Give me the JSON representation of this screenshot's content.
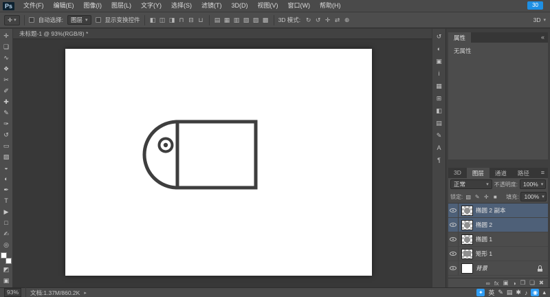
{
  "window": {
    "logo": "Ps",
    "badge": "30"
  },
  "ui": {
    "dropdown_arrow": "▾",
    "collapse_arrow": "«",
    "panel_menu": "≡",
    "status_arrow": "▸"
  },
  "menu_bar": {
    "items": [
      {
        "name": "menu-file",
        "label": "文件(F)"
      },
      {
        "name": "menu-edit",
        "label": "编辑(E)"
      },
      {
        "name": "menu-image",
        "label": "图像(I)"
      },
      {
        "name": "menu-layer",
        "label": "图层(L)"
      },
      {
        "name": "menu-type",
        "label": "文字(Y)"
      },
      {
        "name": "menu-select",
        "label": "选择(S)"
      },
      {
        "name": "menu-filter",
        "label": "滤镜(T)"
      },
      {
        "name": "menu-3d",
        "label": "3D(D)"
      },
      {
        "name": "menu-view",
        "label": "视图(V)"
      },
      {
        "name": "menu-window",
        "label": "窗口(W)"
      },
      {
        "name": "menu-help",
        "label": "帮助(H)"
      }
    ]
  },
  "options_bar": {
    "tool_icon": "✛",
    "auto_select_label": "自动选择:",
    "auto_select_value": "图层",
    "show_transform_label": "显示变换控件",
    "align_icons": [
      {
        "name": "align-left-icon",
        "glyph": "◧"
      },
      {
        "name": "align-center-horizontal-icon",
        "glyph": "◫"
      },
      {
        "name": "align-right-icon",
        "glyph": "◨"
      },
      {
        "name": "align-top-icon",
        "glyph": "⊓"
      },
      {
        "name": "align-center-vertical-icon",
        "glyph": "⊟"
      },
      {
        "name": "align-bottom-icon",
        "glyph": "⊔"
      }
    ],
    "distribute_icons": [
      {
        "name": "distribute-top-icon",
        "glyph": "▤"
      },
      {
        "name": "distribute-vertical-icon",
        "glyph": "▦"
      },
      {
        "name": "distribute-bottom-icon",
        "glyph": "▥"
      },
      {
        "name": "distribute-left-icon",
        "glyph": "▧"
      },
      {
        "name": "distribute-horizontal-icon",
        "glyph": "▨"
      },
      {
        "name": "distribute-right-icon",
        "glyph": "▩"
      }
    ],
    "mode_label": "3D 模式:",
    "mode_icons": [
      {
        "name": "3d-rotate-icon",
        "glyph": "↻"
      },
      {
        "name": "3d-roll-icon",
        "glyph": "↺"
      },
      {
        "name": "3d-drag-icon",
        "glyph": "✛"
      },
      {
        "name": "3d-slide-icon",
        "glyph": "⇄"
      },
      {
        "name": "3d-scale-icon",
        "glyph": "⊕"
      }
    ],
    "workspace_label": "3D"
  },
  "toolbar": {
    "tools": [
      {
        "name": "move-tool",
        "glyph": "✛"
      },
      {
        "name": "rectangular-marquee-tool",
        "glyph": "❏"
      },
      {
        "name": "lasso-tool",
        "glyph": "∿"
      },
      {
        "name": "quick-selection-tool",
        "glyph": "❖"
      },
      {
        "name": "crop-tool",
        "glyph": "✂"
      },
      {
        "name": "eyedropper-tool",
        "glyph": "✐"
      },
      {
        "name": "healing-brush-tool",
        "glyph": "✚"
      },
      {
        "name": "brush-tool",
        "glyph": "✎"
      },
      {
        "name": "clone-stamp-tool",
        "glyph": "✑"
      },
      {
        "name": "history-brush-tool",
        "glyph": "↺"
      },
      {
        "name": "eraser-tool",
        "glyph": "▭"
      },
      {
        "name": "gradient-tool",
        "glyph": "▨"
      },
      {
        "name": "blur-tool",
        "glyph": "◒"
      },
      {
        "name": "dodge-tool",
        "glyph": "◐"
      },
      {
        "name": "pen-tool",
        "glyph": "✒"
      },
      {
        "name": "type-tool",
        "glyph": "T"
      },
      {
        "name": "path-selection-tool",
        "glyph": "▶"
      },
      {
        "name": "rectangle-tool",
        "glyph": "□"
      },
      {
        "name": "hand-tool",
        "glyph": "✍"
      },
      {
        "name": "zoom-tool",
        "glyph": "◎"
      }
    ]
  },
  "document": {
    "tab": "未标题-1 @ 93%(RGB/8) *"
  },
  "canvas": {
    "background": "#ffffff",
    "stroke": "#3e3e3e"
  },
  "panel_dock": {
    "icons": [
      {
        "name": "history-panel-icon",
        "glyph": "↺"
      },
      {
        "name": "adjustments-panel-icon",
        "glyph": "◐"
      },
      {
        "name": "masks-panel-icon",
        "glyph": "▣"
      },
      {
        "name": "info-panel-icon",
        "glyph": "i"
      },
      {
        "name": "histogram-panel-icon",
        "glyph": "▦"
      },
      {
        "name": "navigator-panel-icon",
        "glyph": "⊞"
      },
      {
        "name": "color-panel-icon",
        "glyph": "◧"
      },
      {
        "name": "swatches-panel-icon",
        "glyph": "▤"
      },
      {
        "name": "brush-panel-icon",
        "glyph": "✎"
      },
      {
        "name": "character-panel-icon",
        "glyph": "A"
      },
      {
        "name": "paragraph-panel-icon",
        "glyph": "¶"
      }
    ]
  },
  "properties_panel": {
    "tab": "属性",
    "empty": "无属性"
  },
  "layers_panel": {
    "tabs": [
      {
        "name": "tab-3d",
        "label": "3D",
        "active": false
      },
      {
        "name": "tab-layers",
        "label": "图层",
        "active": true
      },
      {
        "name": "tab-channels",
        "label": "通道",
        "active": false
      },
      {
        "name": "tab-paths",
        "label": "路径",
        "active": false
      }
    ],
    "blend_mode": "正常",
    "opacity_label": "不透明度:",
    "opacity_value": "100%",
    "lock_label": "锁定:",
    "lock_icons": [
      {
        "name": "lock-transparent-pixels-icon",
        "glyph": "▧"
      },
      {
        "name": "lock-image-pixels-icon",
        "glyph": "✎"
      },
      {
        "name": "lock-position-icon",
        "glyph": "✛"
      },
      {
        "name": "lock-all-icon",
        "glyph": "■"
      }
    ],
    "fill_label": "填充:",
    "fill_value": "100%",
    "layers": [
      {
        "name": "椭圆 2 副本",
        "selected": true,
        "thumb": "ellipse",
        "locked": false
      },
      {
        "name": "椭圆 2",
        "selected": true,
        "thumb": "ellipse",
        "locked": false
      },
      {
        "name": "椭圆 1",
        "selected": false,
        "thumb": "ellipse",
        "locked": false
      },
      {
        "name": "矩形 1",
        "selected": false,
        "thumb": "rect",
        "locked": false
      },
      {
        "name": "背景",
        "selected": false,
        "thumb": "background",
        "locked": true
      }
    ],
    "bottom_icons": [
      {
        "name": "link-layers-icon",
        "glyph": "∞"
      },
      {
        "name": "layer-style-icon",
        "glyph": "fx"
      },
      {
        "name": "add-mask-icon",
        "glyph": "▣"
      },
      {
        "name": "adjustment-layer-icon",
        "glyph": "◑"
      },
      {
        "name": "new-group-icon",
        "glyph": "❒"
      },
      {
        "name": "new-layer-icon",
        "glyph": "❏"
      },
      {
        "name": "delete-layer-icon",
        "glyph": "✖"
      }
    ]
  },
  "status_bar": {
    "zoom": "93%",
    "doc_info": "文档:1.37M/860.2K"
  },
  "tray": {
    "icons": [
      {
        "name": "chat-app-icon",
        "glyph": "✦",
        "accent": true
      },
      {
        "name": "ime-language-indicator",
        "glyph": "英",
        "accent": false
      },
      {
        "name": "ime-pen-icon",
        "glyph": "✎",
        "accent": false
      },
      {
        "name": "ime-keyboard-icon",
        "glyph": "▤",
        "accent": false
      },
      {
        "name": "ime-settings-icon",
        "glyph": "✱",
        "accent": false
      },
      {
        "name": "volume-icon",
        "glyph": "♪",
        "accent": false
      },
      {
        "name": "browser-icon",
        "glyph": "◉",
        "accent": true
      },
      {
        "name": "tray-expand-icon",
        "glyph": "▴",
        "accent": false
      }
    ]
  },
  "colors": {
    "selection_blue": "#4e6078",
    "badge_blue": "#1e8fe3",
    "artwork_stroke": "#3e3e3e"
  }
}
